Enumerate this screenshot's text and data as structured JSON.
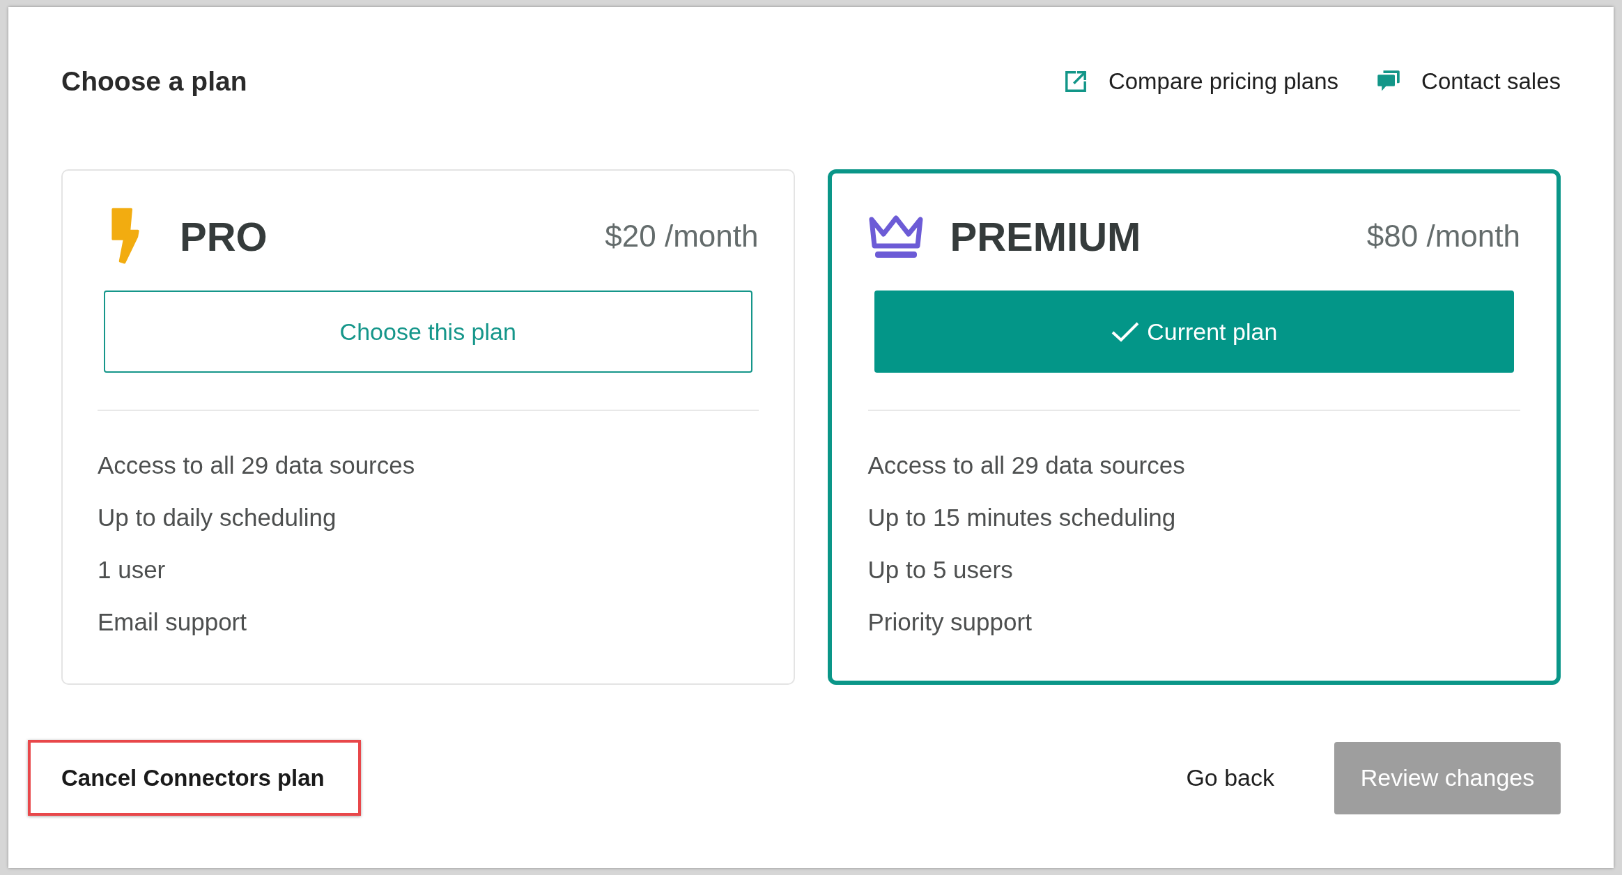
{
  "header": {
    "title": "Choose a plan",
    "links": [
      {
        "kind": "external_link",
        "label": "Compare pricing plans"
      },
      {
        "kind": "contact",
        "label": "Contact sales"
      }
    ]
  },
  "plans": [
    {
      "kind": "pro",
      "name": "PRO",
      "price": "$20 /month",
      "selected": false,
      "button": "Choose this plan",
      "features": [
        "Access to all 29 data sources",
        "Up to daily scheduling",
        "1 user",
        "Email support"
      ]
    },
    {
      "kind": "premium",
      "name": "PREMIUM",
      "price": "$80 /month",
      "selected": true,
      "button": "Current plan",
      "features": [
        "Access to all 29 data sources",
        "Up to 15 minutes scheduling",
        "Up to 5 users",
        "Priority support"
      ]
    }
  ],
  "footer": {
    "cancel": {
      "label": "Cancel Connectors plan",
      "highlighted": true
    },
    "back": "Go back",
    "review": {
      "label": "Review changes",
      "disabled": true
    }
  }
}
